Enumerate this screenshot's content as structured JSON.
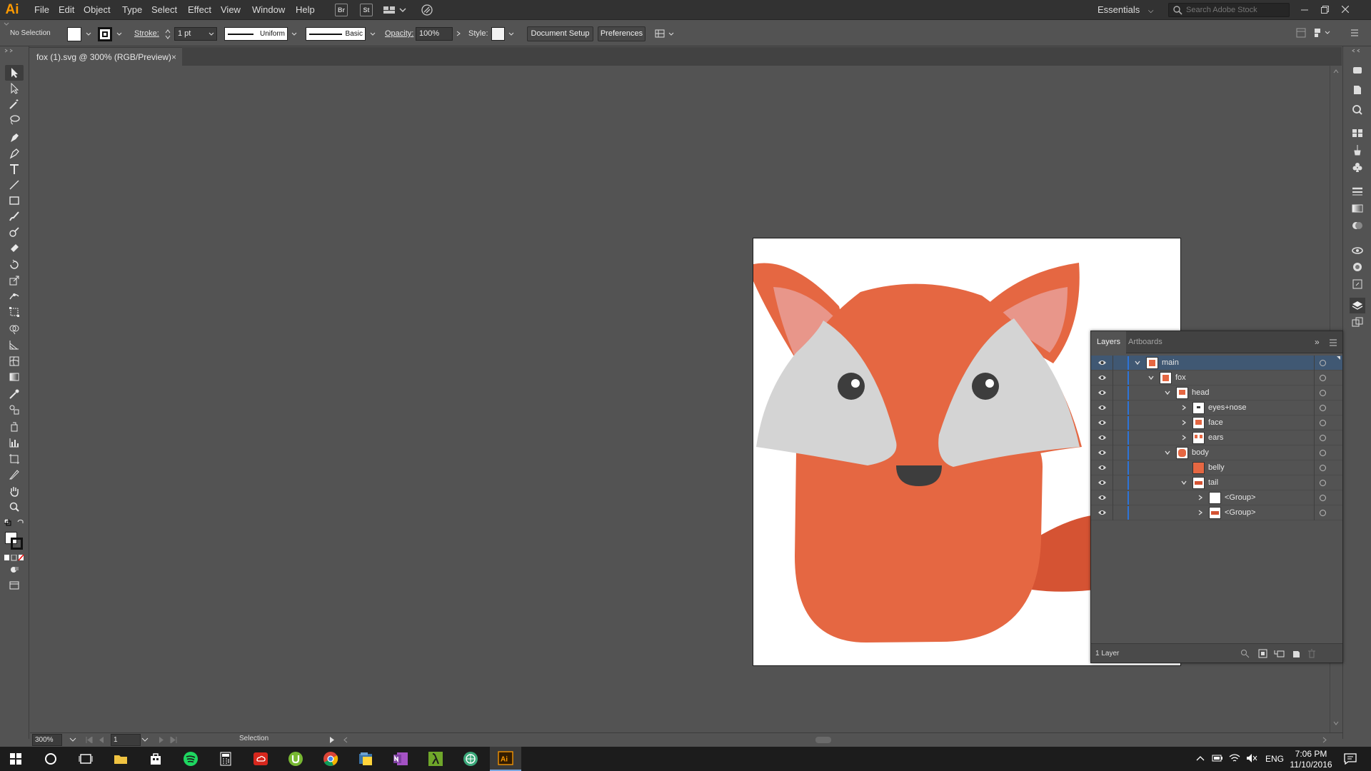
{
  "app": {
    "logo": "Ai",
    "menus": [
      "File",
      "Edit",
      "Object",
      "Type",
      "Select",
      "Effect",
      "View",
      "Window",
      "Help"
    ],
    "bridge_label": "Br",
    "stock_label": "St",
    "workspace": "Essentials",
    "search_placeholder": "Search Adobe Stock"
  },
  "control": {
    "selection": "No Selection",
    "stroke_label": "Stroke:",
    "stroke_weight": "1 pt",
    "profile": "Uniform",
    "brush": "Basic",
    "opacity_label": "Opacity:",
    "opacity": "100%",
    "style_label": "Style:",
    "document_setup": "Document Setup",
    "preferences": "Preferences"
  },
  "document": {
    "tab_title": "fox (1).svg @ 300% (RGB/Preview)",
    "close_glyph": "×"
  },
  "layers_panel": {
    "tabs": [
      "Layers",
      "Artboards"
    ],
    "collapse_glyph": "»",
    "rows": [
      {
        "name": "main",
        "expanded": true
      },
      {
        "name": "fox",
        "expanded": true
      },
      {
        "name": "head",
        "expanded": true
      },
      {
        "name": "eyes+nose",
        "expanded": false
      },
      {
        "name": "face",
        "expanded": false
      },
      {
        "name": "ears",
        "expanded": false
      },
      {
        "name": "body",
        "expanded": true
      },
      {
        "name": "belly",
        "expanded": null
      },
      {
        "name": "tail",
        "expanded": true
      },
      {
        "name": "<Group>",
        "expanded": false
      },
      {
        "name": "<Group>",
        "expanded": false
      }
    ],
    "footer_count": "1 Layer"
  },
  "status": {
    "zoom": "300%",
    "artboard_num": "1",
    "tool_name": "Selection"
  },
  "taskbar": {
    "language": "ENG",
    "time": "7:06 PM",
    "date": "11/10/2016"
  },
  "colors": {
    "fox_orange": "#e56742",
    "fox_tail": "#d55333",
    "ear_inner": "#e8968a",
    "face_grey": "#d4d4d4",
    "eye_dark": "#3d3d3d",
    "selection_blue": "#405873",
    "layer_bar": "#2d74d8"
  }
}
